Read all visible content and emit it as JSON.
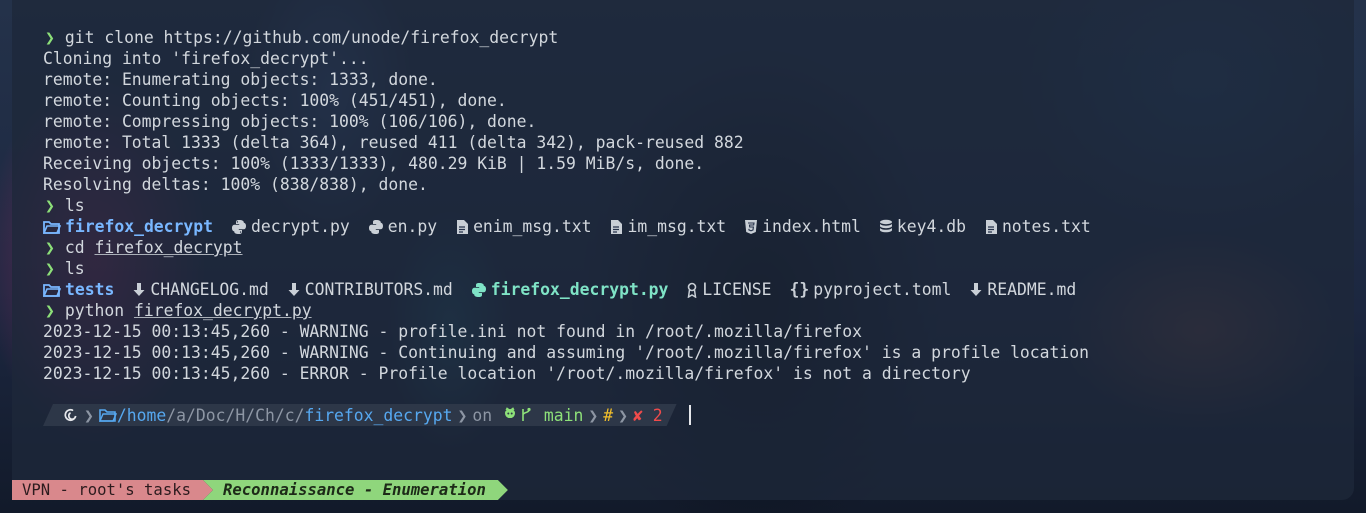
{
  "session": {
    "clone_cmd": "git clone https://github.com/unode/firefox_decrypt",
    "clone_output": [
      "Cloning into 'firefox_decrypt'...",
      "remote: Enumerating objects: 1333, done.",
      "remote: Counting objects: 100% (451/451), done.",
      "remote: Compressing objects: 100% (106/106), done.",
      "remote: Total 1333 (delta 364), reused 411 (delta 342), pack-reused 882",
      "Receiving objects: 100% (1333/1333), 480.29 KiB | 1.59 MiB/s, done.",
      "Resolving deltas: 100% (838/838), done."
    ],
    "ls_cmd": "ls",
    "ls1": [
      {
        "name": "firefox_decrypt",
        "icon": "folder-icon",
        "type": "dir"
      },
      {
        "name": "decrypt.py",
        "icon": "python-icon",
        "type": "file"
      },
      {
        "name": "en.py",
        "icon": "python-icon",
        "type": "file"
      },
      {
        "name": "enim_msg.txt",
        "icon": "file-icon",
        "type": "file"
      },
      {
        "name": "im_msg.txt",
        "icon": "file-icon",
        "type": "file"
      },
      {
        "name": "index.html",
        "icon": "html-icon",
        "type": "file"
      },
      {
        "name": "key4.db",
        "icon": "database-icon",
        "type": "file"
      },
      {
        "name": "notes.txt",
        "icon": "file-icon",
        "type": "file"
      }
    ],
    "cd_cmd": "cd",
    "cd_arg": "firefox_decrypt",
    "ls2": [
      {
        "name": "tests",
        "icon": "folder-icon",
        "type": "dir"
      },
      {
        "name": "CHANGELOG.md",
        "icon": "download-icon",
        "type": "file"
      },
      {
        "name": "CONTRIBUTORS.md",
        "icon": "download-icon",
        "type": "file"
      },
      {
        "name": "firefox_decrypt.py",
        "icon": "python-icon",
        "type": "exec"
      },
      {
        "name": "LICENSE",
        "icon": "license-icon",
        "type": "file"
      },
      {
        "name": "pyproject.toml",
        "icon": "braces-icon",
        "type": "file"
      },
      {
        "name": "README.md",
        "icon": "download-icon",
        "type": "file"
      }
    ],
    "python_cmd": "python",
    "python_arg": "firefox_decrypt.py",
    "log": [
      "2023-12-15 00:13:45,260 - WARNING - profile.ini not found in /root/.mozilla/firefox",
      "2023-12-15 00:13:45,260 - WARNING - Continuing and assuming '/root/.mozilla/firefox' is a profile location",
      "2023-12-15 00:13:45,260 - ERROR - Profile location '/root/.mozilla/firefox' is not a directory"
    ]
  },
  "prompt": {
    "os_icon": "debian-swirl-icon",
    "path_root": "/home",
    "path_parts": [
      "a",
      "Doc",
      "H",
      "Ch",
      "c"
    ],
    "path_current": "firefox_decrypt",
    "on_label": "on",
    "branch_icon": "github-branch-icon",
    "branch": "main",
    "status_marker": "#",
    "error_mark": "✘",
    "exit_code": "2"
  },
  "statusbar": {
    "session": "VPN - root's tasks",
    "window": "Reconnaissance - Enumeration"
  },
  "colors": {
    "prompt_arrow": "#8de079",
    "dir": "#79b7ff",
    "exec": "#7fe3c6",
    "status_session_bg": "#d9888c",
    "status_window_bg": "#8fd67c"
  }
}
